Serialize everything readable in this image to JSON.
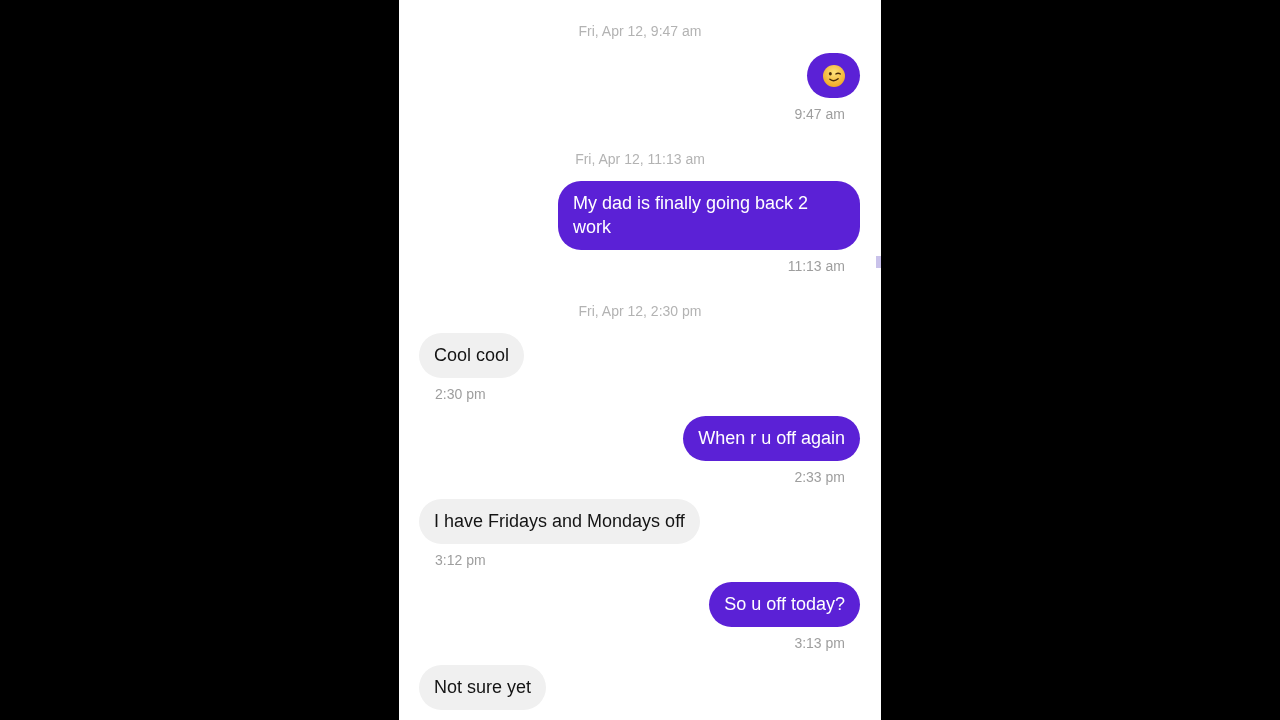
{
  "chat": {
    "groups": [
      {
        "date": "Fri, Apr 12, 9:47 am",
        "messages": [
          {
            "kind": "emoji",
            "outgoing": true,
            "time": "9:47 am"
          }
        ]
      },
      {
        "date": "Fri, Apr 12, 11:13 am",
        "messages": [
          {
            "kind": "text",
            "outgoing": true,
            "text": "My dad is finally going back 2 work",
            "time": "11:13 am"
          }
        ]
      },
      {
        "date": "Fri, Apr 12, 2:30 pm",
        "messages": [
          {
            "kind": "text",
            "outgoing": false,
            "text": "Cool cool",
            "time": "2:30 pm"
          },
          {
            "kind": "text",
            "outgoing": true,
            "text": "When r u off again",
            "time": "2:33 pm"
          },
          {
            "kind": "text",
            "outgoing": false,
            "text": "I have Fridays and Mondays off",
            "time": "3:12 pm"
          },
          {
            "kind": "text",
            "outgoing": true,
            "text": "So u off today?",
            "time": "3:13 pm"
          },
          {
            "kind": "text",
            "outgoing": false,
            "text": "Not sure yet"
          }
        ]
      }
    ]
  }
}
